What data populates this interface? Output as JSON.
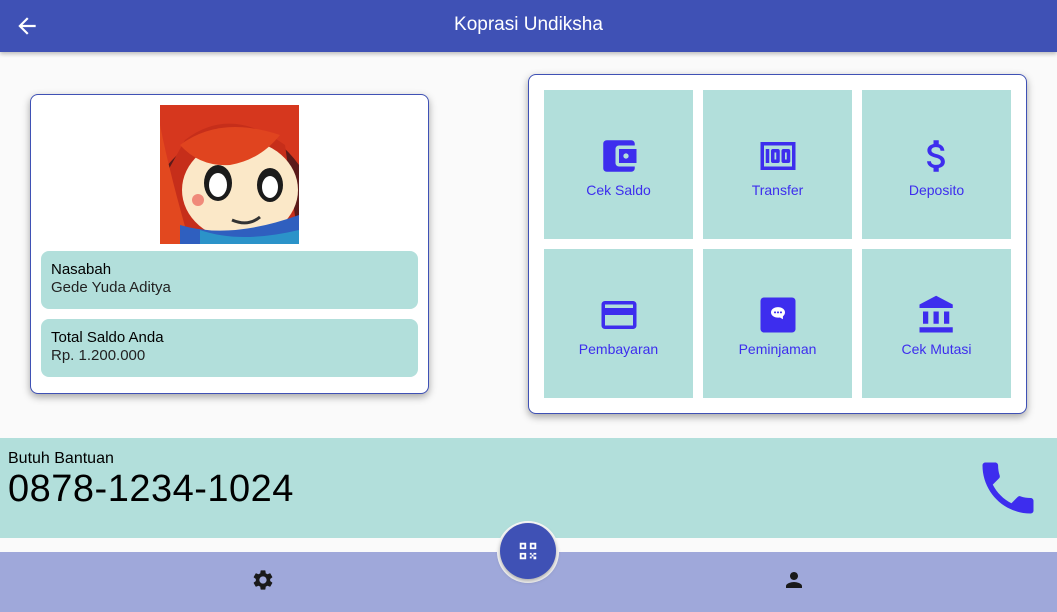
{
  "appbar": {
    "title": "Koprasi Undiksha",
    "back_icon": "arrow-back-icon"
  },
  "profile": {
    "name_label": "Nasabah",
    "name_value": "Gede Yuda Aditya",
    "balance_label": "Total Saldo Anda",
    "balance_value": "Rp. 1.200.000"
  },
  "menu": {
    "items": [
      {
        "label": "Cek Saldo",
        "icon": "wallet-icon"
      },
      {
        "label": "Transfer",
        "icon": "money-icon"
      },
      {
        "label": "Deposito",
        "icon": "dollar-icon"
      },
      {
        "label": "Pembayaran",
        "icon": "credit-card-icon"
      },
      {
        "label": "Peminjaman",
        "icon": "chat-bubble-icon"
      },
      {
        "label": "Cek Mutasi",
        "icon": "bank-icon"
      }
    ]
  },
  "help": {
    "label": "Butuh Bantuan",
    "phone": "0878-1234-1024",
    "icon": "phone-icon"
  },
  "bottom_nav": {
    "left_icon": "settings-icon",
    "center_icon": "qr-scan-icon",
    "right_icon": "person-icon"
  },
  "colors": {
    "primary": "#3f51b5",
    "tile": "#b2dfdb",
    "accent": "#3d2dee",
    "bottom_bar": "#9fa8da"
  }
}
